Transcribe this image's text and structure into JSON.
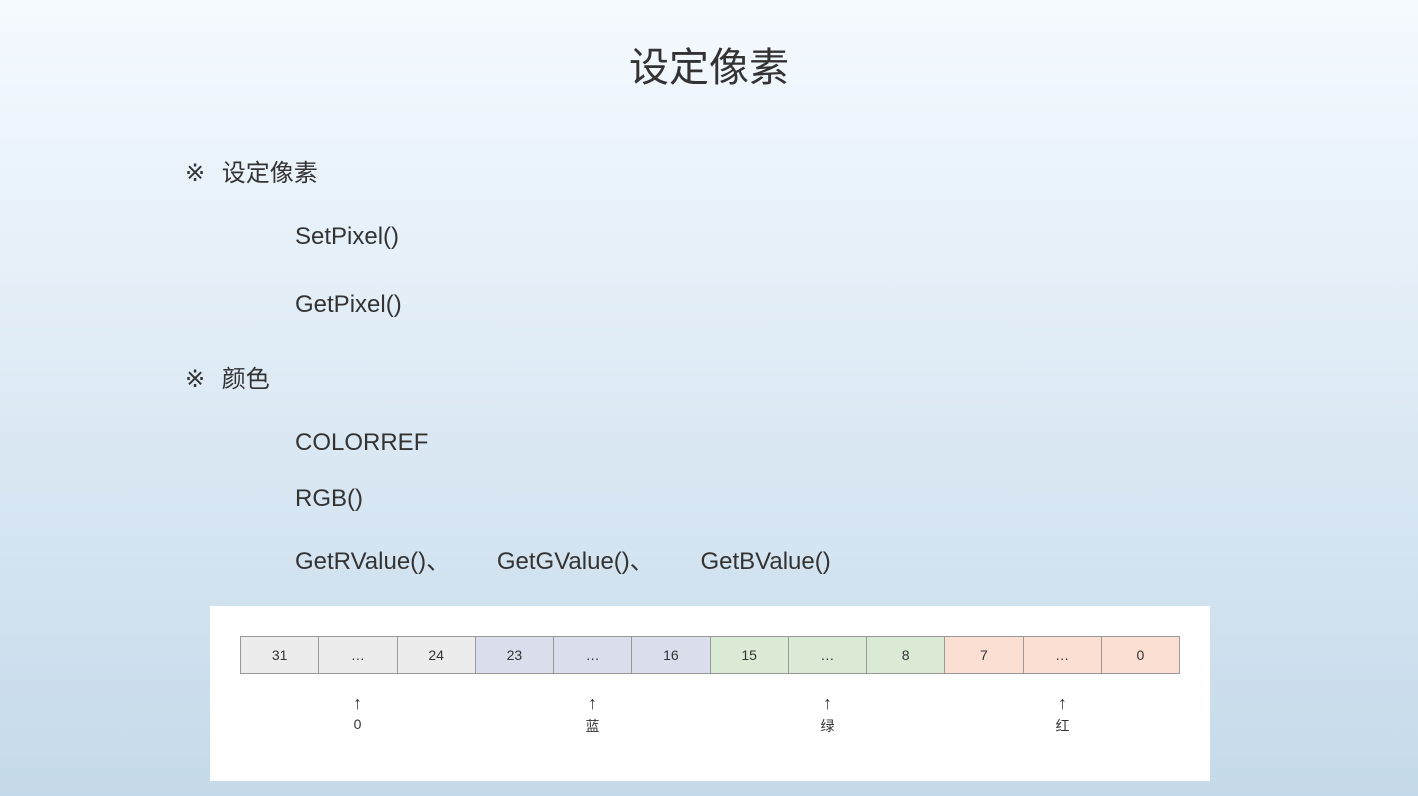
{
  "title": "设定像素",
  "bullet": "※",
  "section1": {
    "label": "设定像素",
    "items": [
      "SetPixel()",
      "GetPixel()"
    ]
  },
  "section2": {
    "label": "颜色",
    "items": [
      "COLORREF",
      "RGB()"
    ],
    "getters": [
      "GetRValue()、",
      "GetGValue()、",
      "GetBValue()"
    ]
  },
  "bits": {
    "cells": [
      "31",
      "…",
      "24",
      "23",
      "…",
      "16",
      "15",
      "…",
      "8",
      "7",
      "…",
      "0"
    ],
    "labels": [
      "0",
      "蓝",
      "绿",
      "红"
    ]
  },
  "arrow": "↑"
}
